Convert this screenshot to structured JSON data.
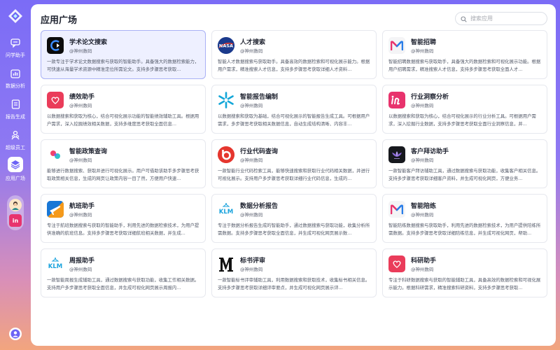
{
  "nav": {
    "items": [
      {
        "label": "问学助手",
        "icon": "chat-bubble-icon"
      },
      {
        "label": "数据分析",
        "icon": "bar-chart-icon"
      },
      {
        "label": "报告生成",
        "icon": "document-icon"
      },
      {
        "label": "超级员工",
        "icon": "people-icon"
      },
      {
        "label": "应用广场",
        "icon": "layers-icon",
        "active": true
      }
    ]
  },
  "header": {
    "title": "应用广场",
    "search_placeholder": "搜索应用"
  },
  "apps": [
    {
      "title": "学术论文搜索",
      "org": "@神州数码",
      "desc": "一款专注于学术论文数据搜索与获取的智能助手。具备强大的数据检索能力，可快速从海量学术资源中精准定位所需论文。支持多步骤思考获取..."
    },
    {
      "title": "人才搜索",
      "org": "@神州数码",
      "desc": "智能人才数据搜索与获取助手。具备高效的数据检索和可视化展示能力。根据用户需求，精准搜索人才信息，支持多步骤思考获取详细人才资料..."
    },
    {
      "title": "智能招聘",
      "org": "@神州数码",
      "desc": "智能招聘数据搜索与获取助手，具备强大的数据检索和可视化展示功能。根据用户招聘需求，精准搜索人才信息，支持多步骤思考获取全面人才..."
    },
    {
      "title": "绩效助手",
      "org": "@神州数码",
      "desc": "以数据搜索和获取为核心，结合可视化展示功能的智能绩效辅助工具。根据用户需求，深入挖掘绩效相关数据，支持多维度思考获取全面信息..."
    },
    {
      "title": "智能报告编制",
      "org": "@神州数码",
      "desc": "以数据搜索和获取为基础，结合可视化展示的智能报告生成工具。可根据用户需求，多步骤思考获取相关数据信息，自动生成结构清晰、内容丰..."
    },
    {
      "title": "行业洞察分析",
      "org": "@神州数码",
      "desc": "以数据搜索和获取为核心，结合可视化展示的行业分析工具。可根据用户需求，深入挖掘行业数据，支持多步骤思考获取全面行业洞察信息，并..."
    },
    {
      "title": "智能政策查询",
      "org": "@神州数码",
      "desc": "能够进行数据搜索、获取并进行可视化展示。用户可借助该助手多步骤思考获取政策相关信息，生成的网页让政策内容一目了然，方便用户快速..."
    },
    {
      "title": "行业代码查询",
      "org": "@神州数码",
      "desc": "一款智能行业代码检索工具，能够快速搜索和获取行业代码相关数据，并进行可视化展示。支持用户多步骤思考获取详细行业代码信息，生成的..."
    },
    {
      "title": "客户拜访助手",
      "org": "@神州数码",
      "desc": "一款智能客户拜访辅助工具，通过数据搜索与获取功能，收集客户相关信息。支持多步骤思考获取详细客户资料，并生成可视化网页，方便业务..."
    },
    {
      "title": "航班助手",
      "org": "@神州数码",
      "desc": "专注于航班数据搜索与获取的智能助手，利用先进的数据检索技术，为用户提供准确的航班信息。支持多步骤思考获取详细航班相关数据，并生成..."
    },
    {
      "title": "数据分析报告",
      "org": "@神州数码",
      "desc": "专注于数据分析报告生成的智能助手，通过数据搜索与获取功能，收集分析所需数据。支持多步骤思考获取全面信息，并生成可视化网页展示数..."
    },
    {
      "title": "智能陪练",
      "org": "@神州数码",
      "desc": "智能陪练数据搜索与获取助手，利用先进的数据检索技术，为用户提供陪练所需数据。支持多步骤思考获取详细陪练信息，并生成可视化网页，帮助..."
    },
    {
      "title": "周报助手",
      "org": "@神州数码",
      "desc": "一款智能周报生成辅助工具，通过数据搜索与获取功能，收集工作相关数据。支持用户多步骤思考获取全面信息，并生成可视化网页展示周报内..."
    },
    {
      "title": "标书评审",
      "org": "@神州数码",
      "desc": "一款智能标书评审辅助工具，利用数据搜索和获取技术，收集标书相关信息。支持多步骤思考获取详细评审要点，并生成可视化网页展示评..."
    },
    {
      "title": "科研助手",
      "org": "@神州数码",
      "desc": "专注于科研数据搜索与获取的智能辅助工具，具备高效的数据检索和可视化展示能力。根据科研需求，精准搜索科研资料，支持多步骤思考获取..."
    }
  ],
  "quick_apps": [
    {
      "icon": "avatar-icon"
    },
    {
      "label": "in",
      "icon": "invision-logo-icon"
    }
  ]
}
